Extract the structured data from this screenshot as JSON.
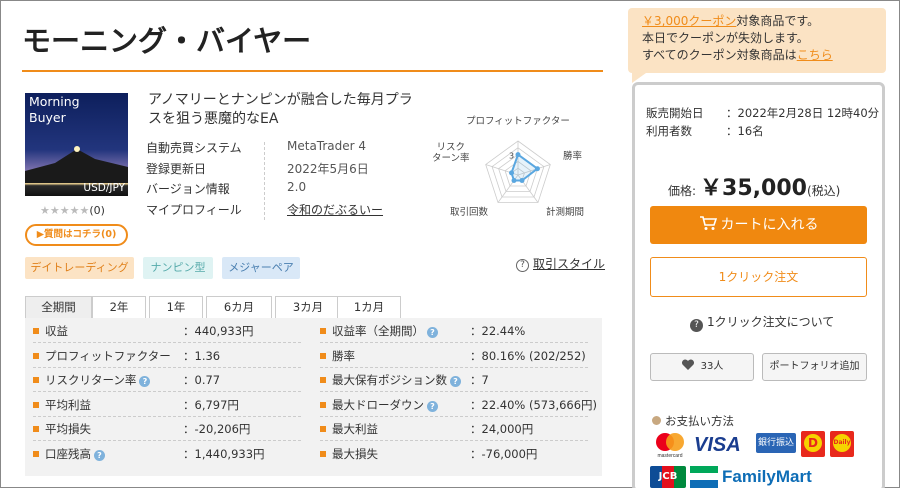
{
  "title": "モーニング・バイヤー",
  "thumbnail": {
    "line1": "Morning",
    "line2": "Buyer",
    "pair": "USD/JPY"
  },
  "rating": {
    "stars": "★★★★★",
    "count": "(0)"
  },
  "question_button": "▶質問はコチラ(0)",
  "description": "アノマリーとナンピンが融合した毎月プラスを狙う悪魔的なEA",
  "info": [
    {
      "key": "自動売買システム",
      "value": "MetaTrader 4"
    },
    {
      "key": "登録更新日",
      "value": "2022年5月6日"
    },
    {
      "key": "バージョン情報",
      "value": "2.0"
    },
    {
      "key": "マイプロフィール",
      "value": "令和のだぶるいー"
    }
  ],
  "radar": {
    "labels": {
      "top": "プロフィットファクター",
      "left": "リスク\nターン率",
      "right": "勝率",
      "bottom_left": "取引回数",
      "bottom_right": "計測期間"
    },
    "values": {
      "profit_factor": 3,
      "win_rate": 3,
      "period": 1,
      "trades": 1,
      "risk_return": 1
    },
    "max": 5,
    "color": "#5aa7e0"
  },
  "tags": [
    {
      "label": "デイトレーディング",
      "bg": "#fce3c4",
      "fg": "#e0801a"
    },
    {
      "label": "ナンピン型",
      "bg": "#dff3f3",
      "fg": "#5aa"
    },
    {
      "label": "メジャーペア",
      "bg": "#d9e8f7",
      "fg": "#4a7fb0"
    }
  ],
  "help_link": "取引スタイル",
  "period_tabs": [
    "全期間",
    "2年",
    "1年",
    "6カ月",
    "3カ月",
    "1カ月"
  ],
  "stats_left": [
    {
      "key": "収益",
      "value": "：440,933円",
      "help": false
    },
    {
      "key": "プロフィットファクター",
      "value": "：1.36",
      "help": false
    },
    {
      "key": "リスクリターン率",
      "value": "：0.77",
      "help": true
    },
    {
      "key": "平均利益",
      "value": "：6,797円",
      "help": false
    },
    {
      "key": "平均損失",
      "value": "：-20,206円",
      "help": false
    },
    {
      "key": "口座残高",
      "value": "：1,440,933円",
      "help": true
    }
  ],
  "stats_right": [
    {
      "key": "収益率（全期間）",
      "value": "：22.44%",
      "help": true
    },
    {
      "key": "勝率",
      "value": "：80.16% (202/252)",
      "help": false
    },
    {
      "key": "最大保有ポジション数",
      "value": "：7",
      "help": true
    },
    {
      "key": "最大ドローダウン",
      "value": "：22.40% (573,666円)",
      "help": true
    },
    {
      "key": "最大利益",
      "value": "：24,000円",
      "help": false
    },
    {
      "key": "最大損失",
      "value": "：-76,000円",
      "help": false
    }
  ],
  "coupon": {
    "amount_link": "￥3,000クーポン",
    "line1_suffix": "対象商品です。",
    "line2": "本日でクーポンが失効します。",
    "line3_prefix": "すべてのクーポン対象商品は",
    "here_link": "こちら"
  },
  "sale": {
    "start_label": "販売開始日",
    "start_value": "：2022年2月28日 12時40分",
    "users_label": "利用者数",
    "users_value": "：16名"
  },
  "price": {
    "label": "価格:",
    "value": "￥35,000",
    "tax": "(税込)"
  },
  "cart_button": "カートに入れる",
  "one_click_button": "1クリック注文",
  "one_click_about": "1クリック注文について",
  "favorite_count": "33人",
  "portfolio_button": "ポートフォリオ追加",
  "payment_title": "お支払い方法",
  "payment_logos": {
    "mastercard": "mastercard",
    "visa": "VISA",
    "bank": "銀行振込",
    "daily": "Daily",
    "jcb": "JCB",
    "familymart": "FamilyMart"
  },
  "colors": {
    "accent": "#f08c1a",
    "coupon_bg": "#fbe3c4"
  }
}
